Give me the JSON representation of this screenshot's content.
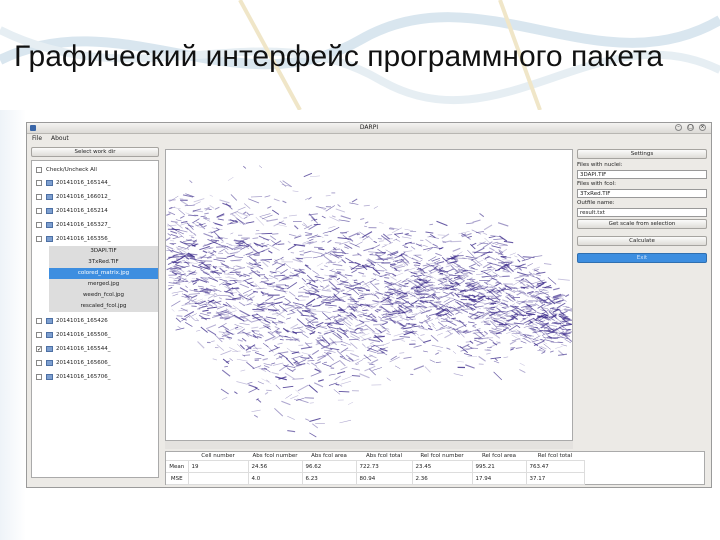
{
  "slide": {
    "title": "Графический интерфейс программного пакета"
  },
  "window": {
    "title": "DARPI",
    "menu": [
      "File",
      "About"
    ]
  },
  "left_panel": {
    "select_button": "Select work dir",
    "check_all": "Check/Uncheck All",
    "folders_top": [
      {
        "name": "20141016_165144_",
        "checked": false
      },
      {
        "name": "20141016_166012_",
        "checked": false
      },
      {
        "name": "20141016_165214",
        "checked": false
      },
      {
        "name": "20141016_165327_",
        "checked": false
      },
      {
        "name": "20141016_165356_",
        "checked": false
      }
    ],
    "files": [
      {
        "name": "3DAPI.TIF",
        "selected": false
      },
      {
        "name": "3TxRed.TIF",
        "selected": false
      },
      {
        "name": "colored_matrix.jpg",
        "selected": true
      },
      {
        "name": "merged.jpg",
        "selected": false
      },
      {
        "name": "weedn_fcol.jpg",
        "selected": false
      },
      {
        "name": "rescaled_fcol.jpg",
        "selected": false
      }
    ],
    "folders_bottom": [
      {
        "name": "20141016_165426",
        "checked": false
      },
      {
        "name": "20141016_165506_",
        "checked": false
      },
      {
        "name": "20141016_165544_",
        "checked": true
      },
      {
        "name": "20141016_165606_",
        "checked": false
      },
      {
        "name": "20141016_165706_",
        "checked": false
      }
    ]
  },
  "right_panel": {
    "settings_button": "Settings",
    "nuclei_label": "Files with nuclei:",
    "nuclei_value": "3DAPI.TIF",
    "fcol_label": "Files with fcol:",
    "fcol_value": "3TxRed.TIF",
    "outfile_label": "Outfile name:",
    "outfile_value": "result.txt",
    "scale_button": "Get scale from selection",
    "calculate_button": "Calculate",
    "exit_button": "Exit"
  },
  "results": {
    "columns": [
      "Cell number",
      "Abs fcol number",
      "Abs fcol area",
      "Abs fcol total",
      "Rel fcol number",
      "Rel fcol area",
      "Rel fcol total"
    ],
    "rows": [
      {
        "label": "Mean",
        "values": [
          "19",
          "24.56",
          "96.62",
          "722.73",
          "23.45",
          "995.21",
          "763.47"
        ]
      },
      {
        "label": "MSE",
        "values": [
          "",
          "4.0",
          "6.23",
          "80.94",
          "2.36",
          "17.94",
          "37.17"
        ]
      }
    ]
  },
  "colors": {
    "stain": "#3b2a8a",
    "selection": "#3d8ee0"
  }
}
